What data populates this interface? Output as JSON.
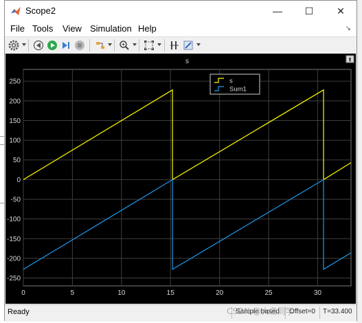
{
  "window": {
    "title": "Scope2",
    "controls": {
      "minimize": "—",
      "maximize": "☐",
      "close": "✕"
    }
  },
  "menu": {
    "items": [
      "File",
      "Tools",
      "View",
      "Simulation",
      "Help"
    ],
    "pin_glyph": "↘"
  },
  "toolbar": {
    "icons": [
      "gear-icon",
      "rewind-icon",
      "run-icon",
      "step-forward-icon",
      "stop-icon",
      "highlight-icon",
      "zoom-icon",
      "fit-to-view-icon",
      "cursor-measure-icon",
      "style-icon"
    ]
  },
  "plot": {
    "title": "s",
    "background": "#000000",
    "grid_color": "#3f3f3f",
    "axis_text_color": "#d9d9d9",
    "undock_glyph": "⬆"
  },
  "chart_data": {
    "type": "line",
    "title": "s",
    "xlabel": "",
    "ylabel": "",
    "xlim": [
      0,
      33.4
    ],
    "ylim": [
      -270,
      280
    ],
    "xticks": [
      0,
      5,
      10,
      15,
      20,
      25,
      30
    ],
    "yticks": [
      250,
      200,
      150,
      100,
      50,
      0,
      -50,
      -100,
      -150,
      -200,
      -250
    ],
    "grid": true,
    "legend_position": "top-right",
    "series": [
      {
        "name": "s",
        "color": "#ffff00",
        "x": [
          0,
          15.2,
          15.2,
          30.6,
          30.6,
          33.4
        ],
        "y": [
          0,
          228,
          0,
          228,
          0,
          43
        ]
      },
      {
        "name": "Sum1",
        "color": "#1e9bf0",
        "x": [
          0,
          15.2,
          15.2,
          30.6,
          30.6,
          33.4
        ],
        "y": [
          -228,
          0,
          -228,
          0,
          -228,
          -186
        ]
      }
    ]
  },
  "status": {
    "ready": "Ready",
    "sample": "Sample based",
    "offset": "Offset=0",
    "time": "T=33.400"
  },
  "watermark": "CSDN @大名同学"
}
